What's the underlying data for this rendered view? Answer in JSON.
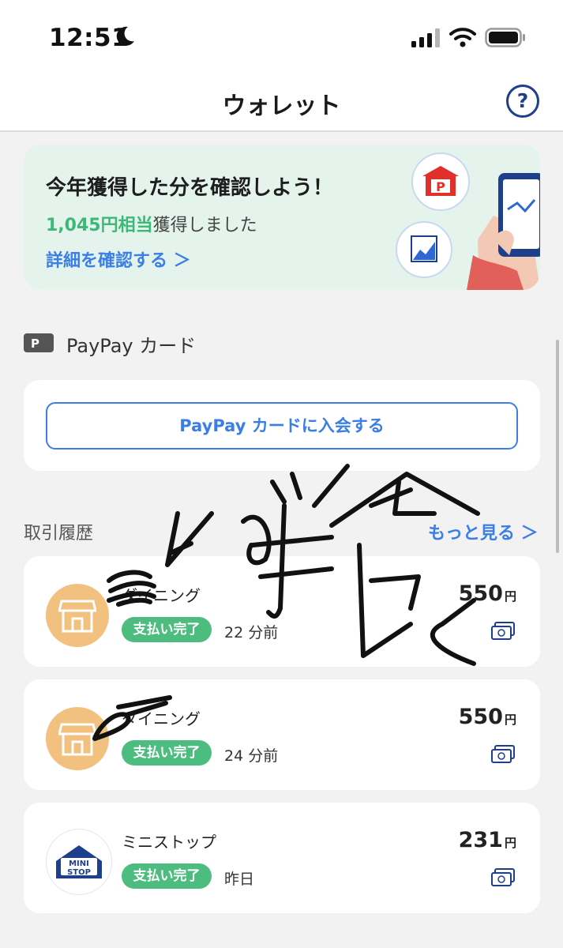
{
  "status_bar": {
    "time": "12:51"
  },
  "nav": {
    "title": "ウォレット",
    "help_label": "?"
  },
  "banner": {
    "title": "今年獲得した分を確認しよう！",
    "earned_amount": "1,045円相当",
    "earned_suffix": "獲得しました",
    "link": "詳細を確認する ＞"
  },
  "paypay_card": {
    "section_label": "PayPay カード",
    "join_button": "PayPay カードに入会する"
  },
  "history": {
    "title": "取引履歴",
    "more_link": "もっと見る ＞",
    "items": [
      {
        "name": "ダイニング",
        "status": "支払い完了",
        "time": "22 分前",
        "amount": "550",
        "currency": "円"
      },
      {
        "name": "ダイニング",
        "status": "支払い完了",
        "time": "24 分前",
        "amount": "550",
        "currency": "円"
      },
      {
        "name": "ミニストップ",
        "status": "支払い完了",
        "time": "昨日",
        "amount": "231",
        "currency": "円"
      }
    ]
  },
  "colors": {
    "accent_blue": "#3b7ee6",
    "nav_blue": "#1e3f8c",
    "success_green": "#4dbd7f",
    "banner_bg": "#e4f4ec"
  },
  "icons": [
    "moon-icon",
    "signal-icon",
    "wifi-icon",
    "battery-icon",
    "help-icon",
    "paypay-card-icon",
    "store-icon",
    "ministop-logo",
    "payment-method-icon"
  ]
}
